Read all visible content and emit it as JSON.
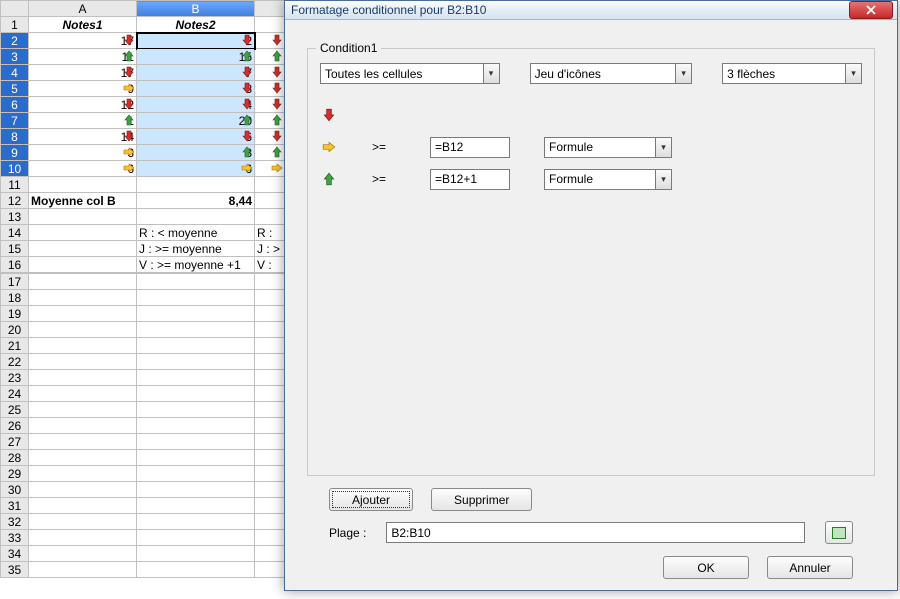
{
  "columns": {
    "A": "A",
    "B": "B"
  },
  "headers": {
    "A": "Notes1",
    "B": "Notes2"
  },
  "rows": [
    {
      "n": 2,
      "A": 17,
      "iA": "down",
      "B": 2,
      "iB": "down",
      "iC": "down"
    },
    {
      "n": 3,
      "A": 11,
      "iA": "up",
      "B": 15,
      "iB": "up",
      "iC": "up"
    },
    {
      "n": 4,
      "A": 17,
      "iA": "down",
      "B": 7,
      "iB": "down",
      "iC": "down"
    },
    {
      "n": 5,
      "A": 9,
      "iA": "right",
      "B": 8,
      "iB": "down",
      "iC": "down"
    },
    {
      "n": 6,
      "A": 12,
      "iA": "down",
      "B": 4,
      "iB": "down",
      "iC": "down"
    },
    {
      "n": 7,
      "A": 1,
      "iA": "up",
      "B": 20,
      "iB": "up",
      "iC": "up"
    },
    {
      "n": 8,
      "A": 14,
      "iA": "down",
      "B": 6,
      "iB": "down",
      "iC": "down"
    },
    {
      "n": 9,
      "A": 3,
      "iA": "right",
      "B": 8,
      "iB": "up",
      "iC": "up"
    },
    {
      "n": 10,
      "A": 6,
      "iA": "right",
      "B": 6,
      "iB": "right",
      "iC": "right"
    }
  ],
  "moy_label": "Moyenne col B",
  "moy_value": "8,44",
  "legend": [
    {
      "a": "R : < moyenne",
      "c": "R :"
    },
    {
      "a": "J : >= moyenne",
      "c": "J : >"
    },
    {
      "a": "V : >= moyenne +1",
      "c": "V :"
    }
  ],
  "dialog": {
    "title": "Formatage conditionnel pour B2:B10",
    "group": "Condition1",
    "sel1": "Toutes les cellules",
    "sel2": "Jeu d'icônes",
    "sel3": "3 flèches",
    "op": ">=",
    "v1": "=B12",
    "v2": "=B12+1",
    "type": "Formule",
    "add": "Ajouter",
    "del": "Supprimer",
    "plage_lbl": "Plage :",
    "plage": "B2:B10",
    "ok": "OK",
    "cancel": "Annuler"
  }
}
